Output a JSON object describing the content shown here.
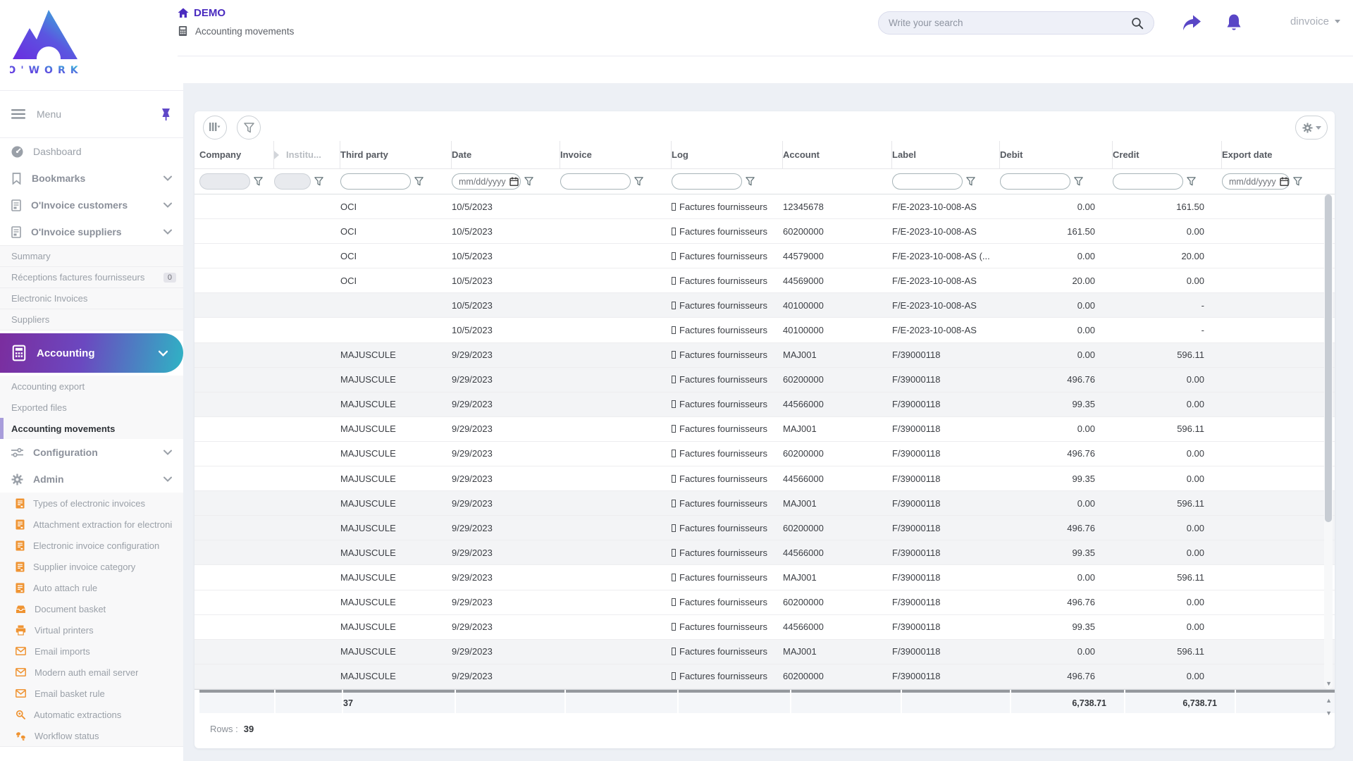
{
  "brand": {
    "name": "O'WORK"
  },
  "header": {
    "app_title": "DEMO",
    "page_title": "Accounting movements",
    "search_placeholder": "Write your search",
    "username": "dinvoice"
  },
  "sidebar": {
    "menu_label": "Menu",
    "dashboard": "Dashboard",
    "bookmarks": "Bookmarks",
    "oinvoice_customers": "O'Invoice customers",
    "oinvoice_suppliers": "O'Invoice suppliers",
    "suppliers_sub": {
      "summary": "Summary",
      "receptions": "Réceptions factures fournisseurs",
      "receptions_badge": "0",
      "electronic_invoices": "Electronic Invoices",
      "suppliers": "Suppliers"
    },
    "accounting": "Accounting",
    "accounting_sub": {
      "export": "Accounting export",
      "exported_files": "Exported files",
      "movements": "Accounting movements"
    },
    "configuration": "Configuration",
    "admin": "Admin",
    "admin_sub": {
      "types": "Types of electronic invoices",
      "attachment": "Attachment extraction for electroni",
      "einvoice_config": "Electronic invoice configuration",
      "supplier_category": "Supplier invoice category",
      "auto_attach": "Auto attach rule",
      "document_basket": "Document basket",
      "virtual_printers": "Virtual printers",
      "email_imports": "Email imports",
      "modern_auth": "Modern auth email server",
      "email_basket": "Email basket rule",
      "auto_extractions": "Automatic extractions",
      "workflow_status": "Workflow status"
    }
  },
  "table": {
    "columns": [
      {
        "key": "company",
        "label": "Company"
      },
      {
        "key": "institution",
        "label": "Institu..."
      },
      {
        "key": "third_party",
        "label": "Third party"
      },
      {
        "key": "date",
        "label": "Date"
      },
      {
        "key": "invoice",
        "label": "Invoice"
      },
      {
        "key": "log",
        "label": "Log"
      },
      {
        "key": "account",
        "label": "Account"
      },
      {
        "key": "label",
        "label": "Label"
      },
      {
        "key": "debit",
        "label": "Debit"
      },
      {
        "key": "credit",
        "label": "Credit"
      },
      {
        "key": "export_date",
        "label": "Export date"
      }
    ],
    "date_placeholder": "mm/dd/yyyy",
    "log_text": "Factures fournisseurs",
    "rows": [
      {
        "third_party": "OCI",
        "date": "10/5/2023",
        "account": "12345678",
        "label": "F/E-2023-10-008-AS",
        "debit": "0.00",
        "credit": "161.50",
        "shaded": false
      },
      {
        "third_party": "OCI",
        "date": "10/5/2023",
        "account": "60200000",
        "label": "F/E-2023-10-008-AS",
        "debit": "161.50",
        "credit": "0.00",
        "shaded": false
      },
      {
        "third_party": "OCI",
        "date": "10/5/2023",
        "account": "44579000",
        "label": "F/E-2023-10-008-AS (...",
        "debit": "0.00",
        "credit": "20.00",
        "shaded": false
      },
      {
        "third_party": "OCI",
        "date": "10/5/2023",
        "account": "44569000",
        "label": "F/E-2023-10-008-AS",
        "debit": "20.00",
        "credit": "0.00",
        "shaded": false
      },
      {
        "third_party": "",
        "date": "10/5/2023",
        "account": "40100000",
        "label": "F/E-2023-10-008-AS",
        "debit": "0.00",
        "credit": "-",
        "shaded": true
      },
      {
        "third_party": "",
        "date": "10/5/2023",
        "account": "40100000",
        "label": "F/E-2023-10-008-AS",
        "debit": "0.00",
        "credit": "-",
        "shaded": false
      },
      {
        "third_party": "MAJUSCULE",
        "date": "9/29/2023",
        "account": "MAJ001",
        "label": "F/39000118",
        "debit": "0.00",
        "credit": "596.11",
        "shaded": true
      },
      {
        "third_party": "MAJUSCULE",
        "date": "9/29/2023",
        "account": "60200000",
        "label": "F/39000118",
        "debit": "496.76",
        "credit": "0.00",
        "shaded": true
      },
      {
        "third_party": "MAJUSCULE",
        "date": "9/29/2023",
        "account": "44566000",
        "label": "F/39000118",
        "debit": "99.35",
        "credit": "0.00",
        "shaded": true
      },
      {
        "third_party": "MAJUSCULE",
        "date": "9/29/2023",
        "account": "MAJ001",
        "label": "F/39000118",
        "debit": "0.00",
        "credit": "596.11",
        "shaded": false
      },
      {
        "third_party": "MAJUSCULE",
        "date": "9/29/2023",
        "account": "60200000",
        "label": "F/39000118",
        "debit": "496.76",
        "credit": "0.00",
        "shaded": false
      },
      {
        "third_party": "MAJUSCULE",
        "date": "9/29/2023",
        "account": "44566000",
        "label": "F/39000118",
        "debit": "99.35",
        "credit": "0.00",
        "shaded": false
      },
      {
        "third_party": "MAJUSCULE",
        "date": "9/29/2023",
        "account": "MAJ001",
        "label": "F/39000118",
        "debit": "0.00",
        "credit": "596.11",
        "shaded": true
      },
      {
        "third_party": "MAJUSCULE",
        "date": "9/29/2023",
        "account": "60200000",
        "label": "F/39000118",
        "debit": "496.76",
        "credit": "0.00",
        "shaded": true
      },
      {
        "third_party": "MAJUSCULE",
        "date": "9/29/2023",
        "account": "44566000",
        "label": "F/39000118",
        "debit": "99.35",
        "credit": "0.00",
        "shaded": true
      },
      {
        "third_party": "MAJUSCULE",
        "date": "9/29/2023",
        "account": "MAJ001",
        "label": "F/39000118",
        "debit": "0.00",
        "credit": "596.11",
        "shaded": false
      },
      {
        "third_party": "MAJUSCULE",
        "date": "9/29/2023",
        "account": "60200000",
        "label": "F/39000118",
        "debit": "496.76",
        "credit": "0.00",
        "shaded": false
      },
      {
        "third_party": "MAJUSCULE",
        "date": "9/29/2023",
        "account": "44566000",
        "label": "F/39000118",
        "debit": "99.35",
        "credit": "0.00",
        "shaded": false
      },
      {
        "third_party": "MAJUSCULE",
        "date": "9/29/2023",
        "account": "MAJ001",
        "label": "F/39000118",
        "debit": "0.00",
        "credit": "596.11",
        "shaded": true
      },
      {
        "third_party": "MAJUSCULE",
        "date": "9/29/2023",
        "account": "60200000",
        "label": "F/39000118",
        "debit": "496.76",
        "credit": "0.00",
        "shaded": true
      }
    ],
    "totals": {
      "third_party_count": "37",
      "debit": "6,738.71",
      "credit": "6,738.71"
    },
    "footer": {
      "rows_label": "Rows :",
      "rows_value": "39"
    }
  },
  "colors": {
    "accent_purple": "#5946c6",
    "gradient_start": "#7b2d9e",
    "gradient_end": "#2fb3c4",
    "icon_orange": "#ef9433",
    "page_background": "#edf0f5"
  }
}
